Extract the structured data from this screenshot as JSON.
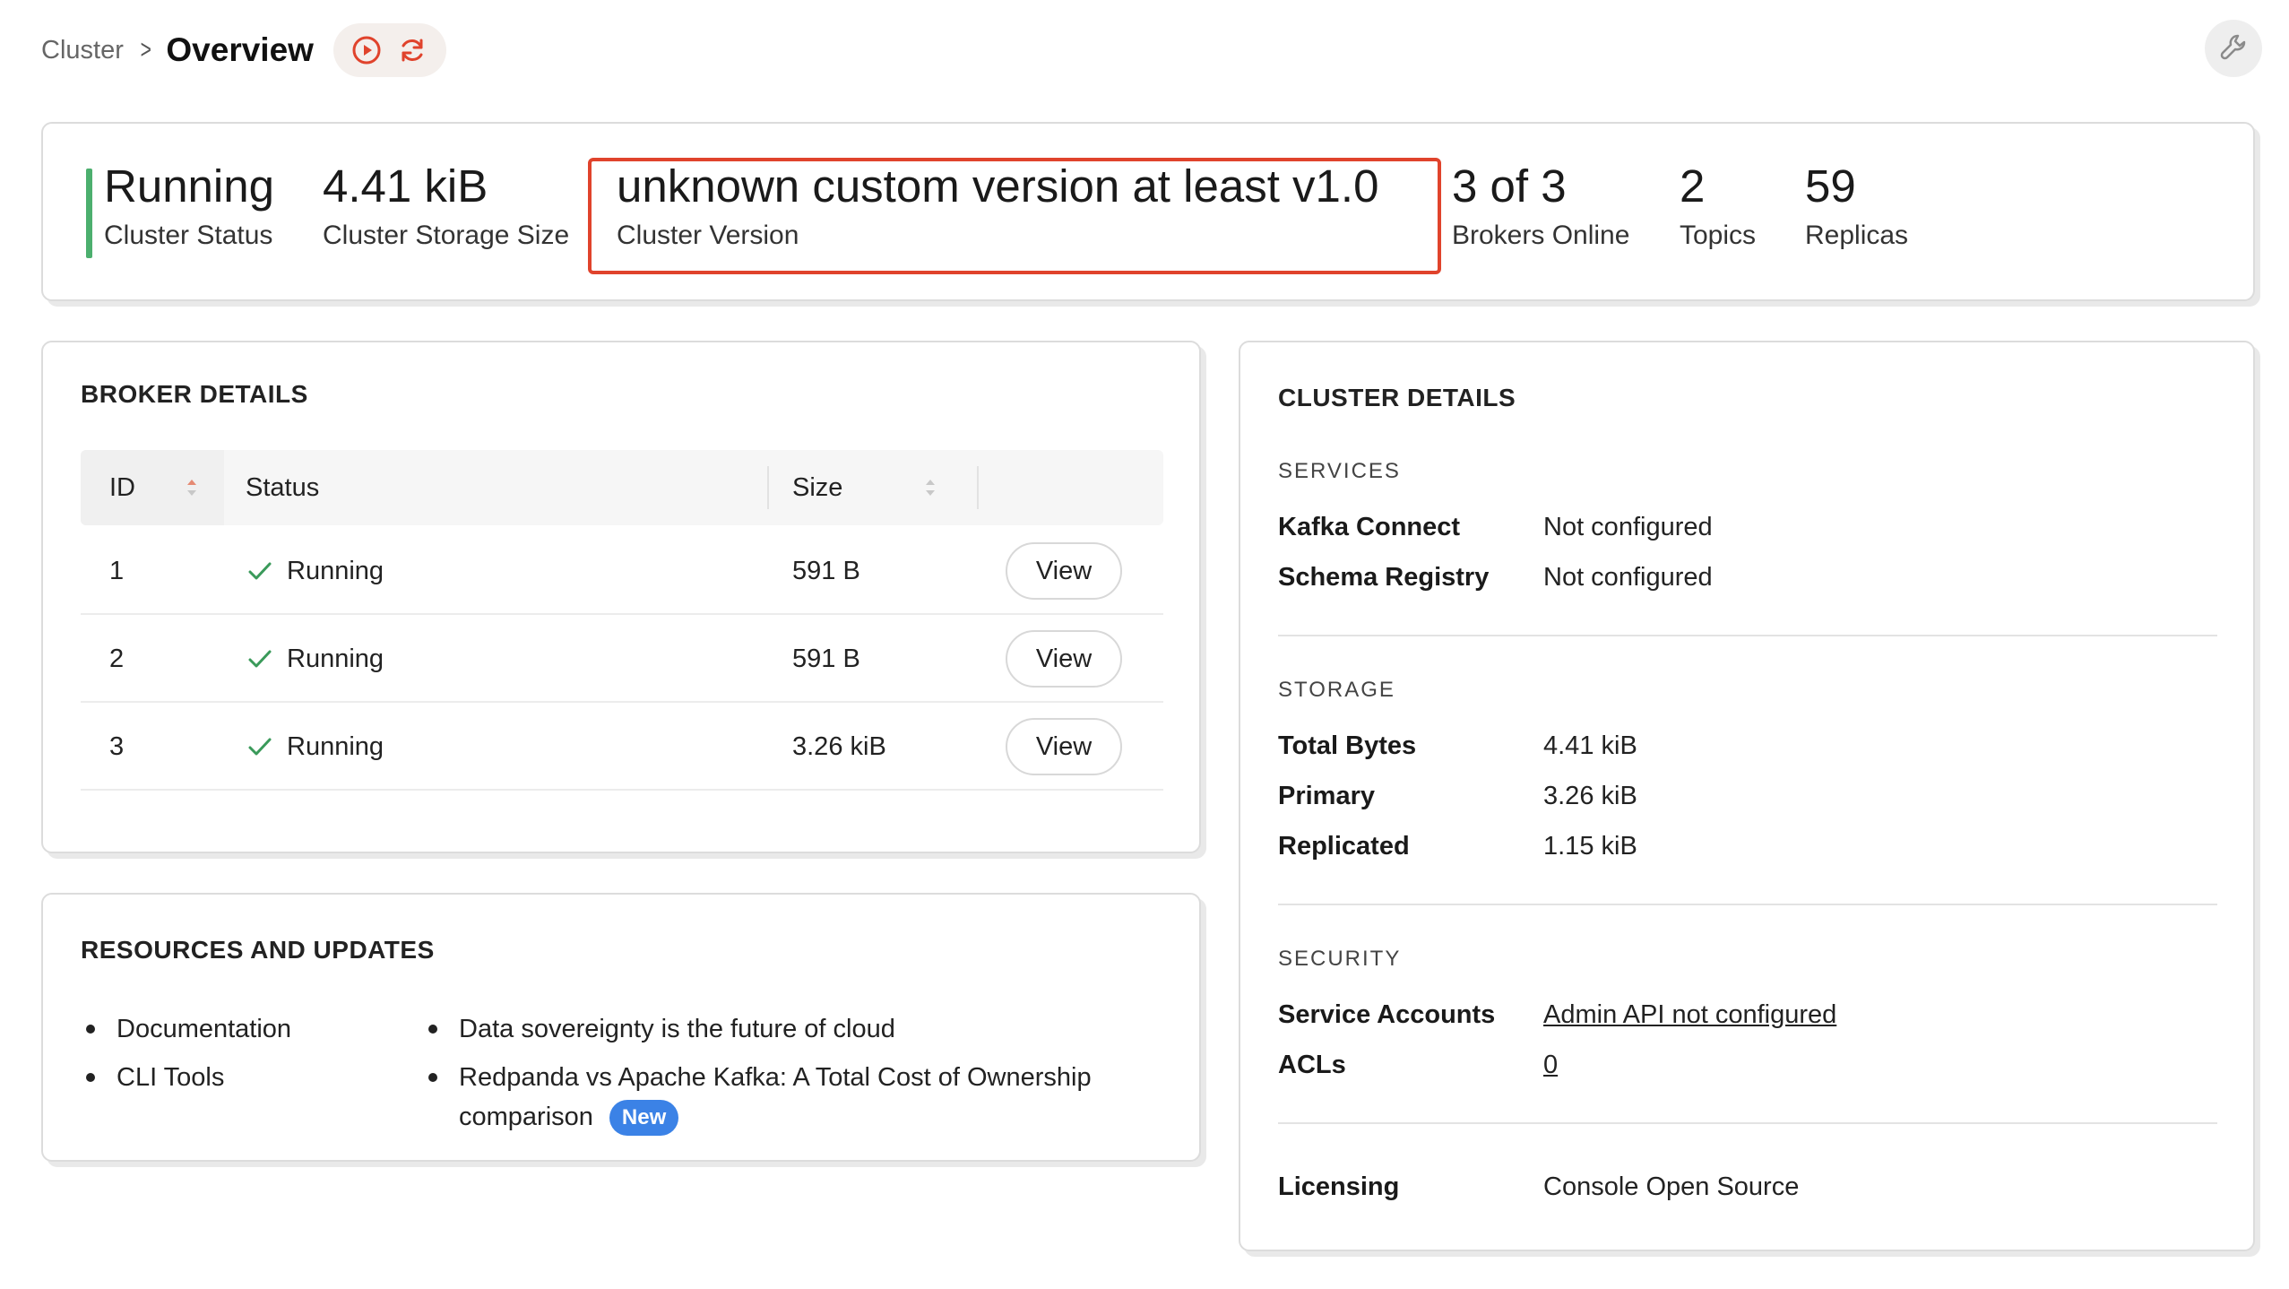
{
  "header": {
    "breadcrumb": "Cluster",
    "title": "Overview",
    "icons": [
      "play-circle-icon",
      "refresh-icon",
      "wrench-icon"
    ],
    "accent_color": "#e0432c"
  },
  "stats": [
    {
      "value": "Running",
      "label": "Cluster Status"
    },
    {
      "value": "4.41 kiB",
      "label": "Cluster Storage Size"
    },
    {
      "value": "unknown custom version at least v1.0",
      "label": "Cluster Version"
    },
    {
      "value": "3 of 3",
      "label": "Brokers Online"
    },
    {
      "value": "2",
      "label": "Topics"
    },
    {
      "value": "59",
      "label": "Replicas"
    }
  ],
  "broker_details": {
    "title": "BROKER DETAILS",
    "columns": [
      "ID",
      "Status",
      "Size"
    ],
    "rows": [
      {
        "id": "1",
        "status": "Running",
        "size": "591 B",
        "action": "View"
      },
      {
        "id": "2",
        "status": "Running",
        "size": "591 B",
        "action": "View"
      },
      {
        "id": "3",
        "status": "Running",
        "size": "3.26 kiB",
        "action": "View"
      }
    ]
  },
  "resources": {
    "title": "RESOURCES AND UPDATES",
    "left_links": [
      "Documentation",
      "CLI Tools"
    ],
    "right_links": [
      "Data sovereignty is the future of cloud",
      "Redpanda vs Apache Kafka: A Total Cost of Ownership comparison"
    ],
    "badge": "New",
    "badge_color": "#3b82e6"
  },
  "cluster_details": {
    "title": "CLUSTER DETAILS",
    "services": {
      "heading": "SERVICES",
      "items": [
        {
          "key": "Kafka Connect",
          "value": "Not configured"
        },
        {
          "key": "Schema Registry",
          "value": "Not configured"
        }
      ]
    },
    "storage": {
      "heading": "STORAGE",
      "items": [
        {
          "key": "Total Bytes",
          "value": "4.41 kiB"
        },
        {
          "key": "Primary",
          "value": "3.26 kiB"
        },
        {
          "key": "Replicated",
          "value": "1.15 kiB"
        }
      ]
    },
    "security": {
      "heading": "SECURITY",
      "items": [
        {
          "key": "Service Accounts",
          "value": "Admin API not configured"
        },
        {
          "key": "ACLs",
          "value": "0"
        }
      ]
    },
    "licensing": {
      "key": "Licensing",
      "value": "Console Open Source"
    }
  }
}
